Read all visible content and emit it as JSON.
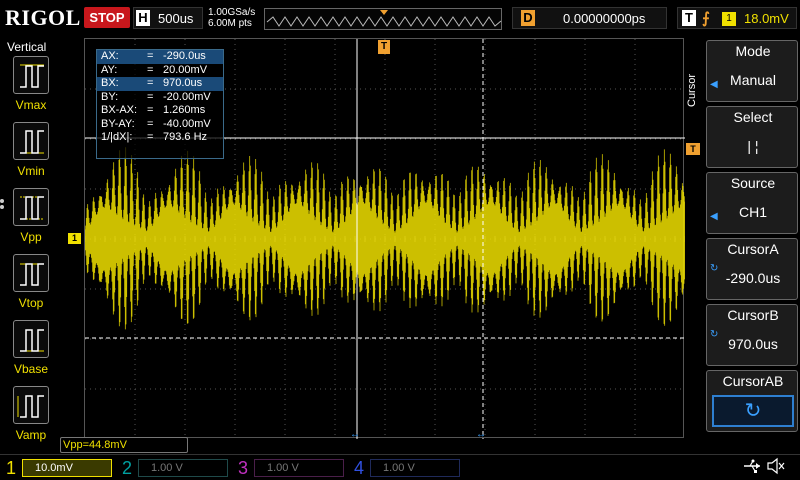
{
  "topbar": {
    "brand": "RIGOL",
    "run_state": "STOP",
    "horizontal_label": "H",
    "timebase": "500us",
    "sample_rate": "1.00GSa/s",
    "memory_depth": "6.00M pts",
    "delay_label": "D",
    "delay": "0.00000000ps",
    "trigger_label": "T",
    "trigger_source": "1",
    "trigger_level": "18.0mV"
  },
  "left_panel": {
    "title": "Vertical",
    "items": [
      "Vmax",
      "Vmin",
      "Vpp",
      "Vtop",
      "Vbase",
      "Vamp"
    ]
  },
  "cursor_info": {
    "rows": [
      {
        "key": "AX:",
        "eq": "=",
        "val": "-290.0us",
        "highlight": true
      },
      {
        "key": "AY:",
        "eq": "=",
        "val": "20.00mV",
        "highlight": false
      },
      {
        "key": "BX:",
        "eq": "=",
        "val": "970.0us",
        "highlight": true
      },
      {
        "key": "BY:",
        "eq": "=",
        "val": "-20.00mV",
        "highlight": false
      },
      {
        "key": "BX-AX:",
        "eq": "=",
        "val": "1.260ms",
        "highlight": false
      },
      {
        "key": "BY-AY:",
        "eq": "=",
        "val": "-40.00mV",
        "highlight": false
      },
      {
        "key": "1/|dX|:",
        "eq": "=",
        "val": "793.6 Hz",
        "highlight": false
      }
    ]
  },
  "markers": {
    "ch1": "1",
    "trigger_top": "T",
    "trigger_level": "T"
  },
  "measurement": {
    "vpp": "Vpp=44.8mV"
  },
  "channels": [
    {
      "num": "1",
      "scale": "10.0mV"
    },
    {
      "num": "2",
      "scale": "1.00 V"
    },
    {
      "num": "3",
      "scale": "1.00 V"
    },
    {
      "num": "4",
      "scale": "1.00 V"
    }
  ],
  "menu": {
    "title": "Cursor",
    "items": [
      {
        "label": "Mode",
        "value": "Manual"
      },
      {
        "label": "Select",
        "value": "|   ¦"
      },
      {
        "label": "Source",
        "value": "CH1"
      },
      {
        "label": "CursorA",
        "value": "-290.0us"
      },
      {
        "label": "CursorB",
        "value": "970.0us"
      },
      {
        "label": "CursorAB",
        "value": "↻"
      }
    ]
  },
  "colors": {
    "ch1": "#f0e000",
    "ch2": "#00a0a0",
    "ch3": "#c030c0",
    "ch4": "#3050e0",
    "trigger": "#f0a030",
    "stop": "#c8171c",
    "accent": "#3aa0ff"
  }
}
